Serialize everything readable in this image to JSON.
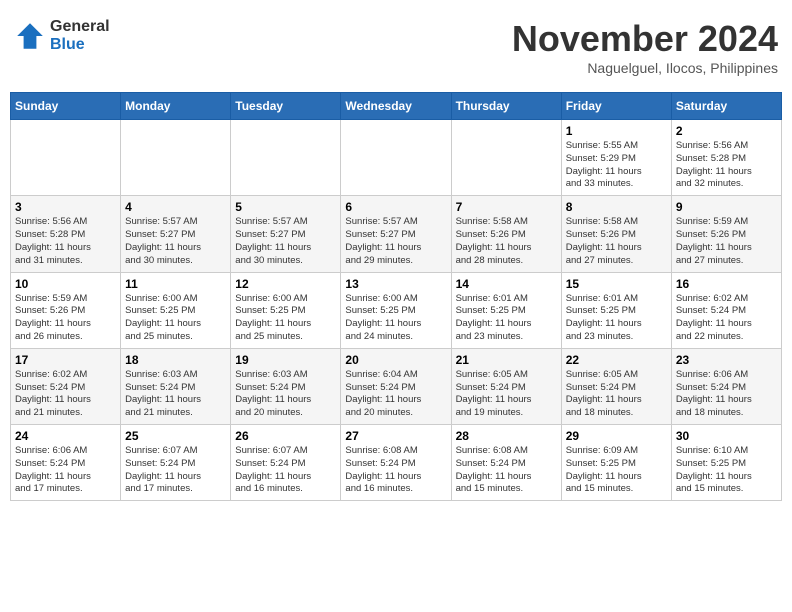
{
  "header": {
    "logo_general": "General",
    "logo_blue": "Blue",
    "month_title": "November 2024",
    "location": "Naguelguel, Ilocos, Philippines"
  },
  "weekdays": [
    "Sunday",
    "Monday",
    "Tuesday",
    "Wednesday",
    "Thursday",
    "Friday",
    "Saturday"
  ],
  "weeks": [
    [
      {
        "day": "",
        "info": ""
      },
      {
        "day": "",
        "info": ""
      },
      {
        "day": "",
        "info": ""
      },
      {
        "day": "",
        "info": ""
      },
      {
        "day": "",
        "info": ""
      },
      {
        "day": "1",
        "info": "Sunrise: 5:55 AM\nSunset: 5:29 PM\nDaylight: 11 hours\nand 33 minutes."
      },
      {
        "day": "2",
        "info": "Sunrise: 5:56 AM\nSunset: 5:28 PM\nDaylight: 11 hours\nand 32 minutes."
      }
    ],
    [
      {
        "day": "3",
        "info": "Sunrise: 5:56 AM\nSunset: 5:28 PM\nDaylight: 11 hours\nand 31 minutes."
      },
      {
        "day": "4",
        "info": "Sunrise: 5:57 AM\nSunset: 5:27 PM\nDaylight: 11 hours\nand 30 minutes."
      },
      {
        "day": "5",
        "info": "Sunrise: 5:57 AM\nSunset: 5:27 PM\nDaylight: 11 hours\nand 30 minutes."
      },
      {
        "day": "6",
        "info": "Sunrise: 5:57 AM\nSunset: 5:27 PM\nDaylight: 11 hours\nand 29 minutes."
      },
      {
        "day": "7",
        "info": "Sunrise: 5:58 AM\nSunset: 5:26 PM\nDaylight: 11 hours\nand 28 minutes."
      },
      {
        "day": "8",
        "info": "Sunrise: 5:58 AM\nSunset: 5:26 PM\nDaylight: 11 hours\nand 27 minutes."
      },
      {
        "day": "9",
        "info": "Sunrise: 5:59 AM\nSunset: 5:26 PM\nDaylight: 11 hours\nand 27 minutes."
      }
    ],
    [
      {
        "day": "10",
        "info": "Sunrise: 5:59 AM\nSunset: 5:26 PM\nDaylight: 11 hours\nand 26 minutes."
      },
      {
        "day": "11",
        "info": "Sunrise: 6:00 AM\nSunset: 5:25 PM\nDaylight: 11 hours\nand 25 minutes."
      },
      {
        "day": "12",
        "info": "Sunrise: 6:00 AM\nSunset: 5:25 PM\nDaylight: 11 hours\nand 25 minutes."
      },
      {
        "day": "13",
        "info": "Sunrise: 6:00 AM\nSunset: 5:25 PM\nDaylight: 11 hours\nand 24 minutes."
      },
      {
        "day": "14",
        "info": "Sunrise: 6:01 AM\nSunset: 5:25 PM\nDaylight: 11 hours\nand 23 minutes."
      },
      {
        "day": "15",
        "info": "Sunrise: 6:01 AM\nSunset: 5:25 PM\nDaylight: 11 hours\nand 23 minutes."
      },
      {
        "day": "16",
        "info": "Sunrise: 6:02 AM\nSunset: 5:24 PM\nDaylight: 11 hours\nand 22 minutes."
      }
    ],
    [
      {
        "day": "17",
        "info": "Sunrise: 6:02 AM\nSunset: 5:24 PM\nDaylight: 11 hours\nand 21 minutes."
      },
      {
        "day": "18",
        "info": "Sunrise: 6:03 AM\nSunset: 5:24 PM\nDaylight: 11 hours\nand 21 minutes."
      },
      {
        "day": "19",
        "info": "Sunrise: 6:03 AM\nSunset: 5:24 PM\nDaylight: 11 hours\nand 20 minutes."
      },
      {
        "day": "20",
        "info": "Sunrise: 6:04 AM\nSunset: 5:24 PM\nDaylight: 11 hours\nand 20 minutes."
      },
      {
        "day": "21",
        "info": "Sunrise: 6:05 AM\nSunset: 5:24 PM\nDaylight: 11 hours\nand 19 minutes."
      },
      {
        "day": "22",
        "info": "Sunrise: 6:05 AM\nSunset: 5:24 PM\nDaylight: 11 hours\nand 18 minutes."
      },
      {
        "day": "23",
        "info": "Sunrise: 6:06 AM\nSunset: 5:24 PM\nDaylight: 11 hours\nand 18 minutes."
      }
    ],
    [
      {
        "day": "24",
        "info": "Sunrise: 6:06 AM\nSunset: 5:24 PM\nDaylight: 11 hours\nand 17 minutes."
      },
      {
        "day": "25",
        "info": "Sunrise: 6:07 AM\nSunset: 5:24 PM\nDaylight: 11 hours\nand 17 minutes."
      },
      {
        "day": "26",
        "info": "Sunrise: 6:07 AM\nSunset: 5:24 PM\nDaylight: 11 hours\nand 16 minutes."
      },
      {
        "day": "27",
        "info": "Sunrise: 6:08 AM\nSunset: 5:24 PM\nDaylight: 11 hours\nand 16 minutes."
      },
      {
        "day": "28",
        "info": "Sunrise: 6:08 AM\nSunset: 5:24 PM\nDaylight: 11 hours\nand 15 minutes."
      },
      {
        "day": "29",
        "info": "Sunrise: 6:09 AM\nSunset: 5:25 PM\nDaylight: 11 hours\nand 15 minutes."
      },
      {
        "day": "30",
        "info": "Sunrise: 6:10 AM\nSunset: 5:25 PM\nDaylight: 11 hours\nand 15 minutes."
      }
    ]
  ]
}
